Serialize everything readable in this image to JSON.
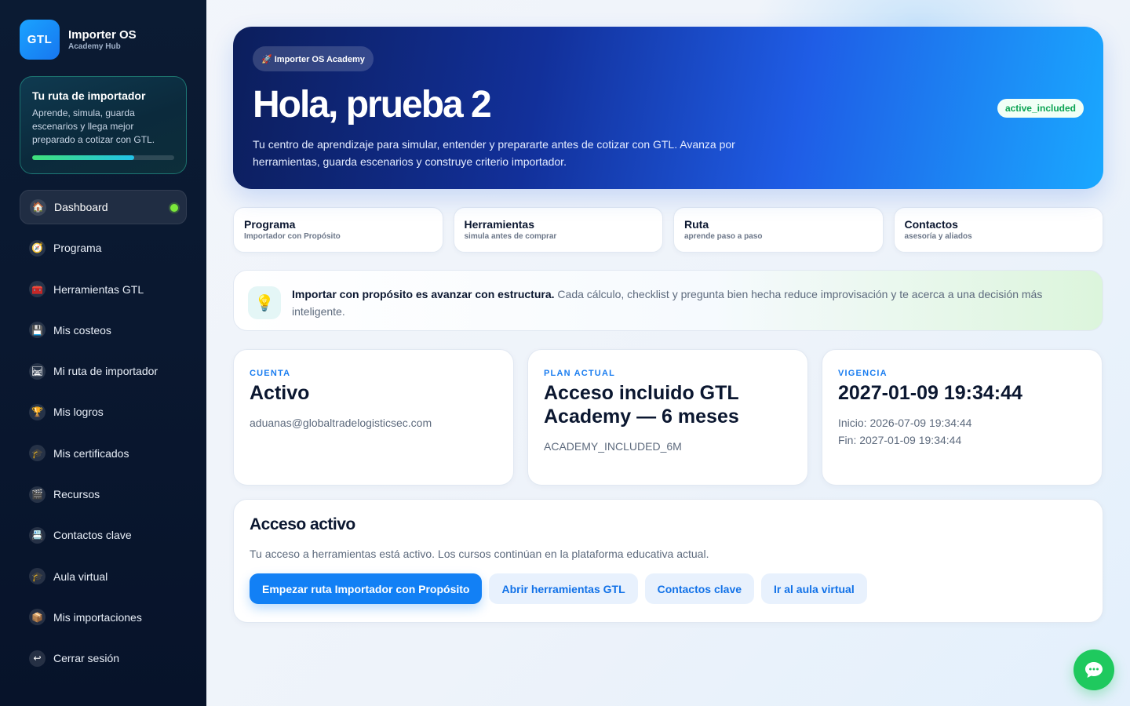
{
  "brand": {
    "logo": "GTL",
    "title": "Importer OS",
    "subtitle": "Academy Hub"
  },
  "route_card": {
    "title": "Tu ruta de importador",
    "text": "Aprende, simula, guarda escenarios y llega mejor preparado a cotizar con GTL.",
    "progress": 0.72
  },
  "nav": [
    {
      "label": "Dashboard",
      "icon": "house-icon",
      "glyph": "🏠",
      "active": true
    },
    {
      "label": "Programa",
      "icon": "compass-icon",
      "glyph": "🧭"
    },
    {
      "label": "Herramientas GTL",
      "icon": "toolbox-icon",
      "glyph": "🧰"
    },
    {
      "label": "Mis costeos",
      "icon": "floppy-disk-icon",
      "glyph": "💾"
    },
    {
      "label": "Mi ruta de importador",
      "icon": "route-icon",
      "glyph": "🛤"
    },
    {
      "label": "Mis logros",
      "icon": "trophy-icon",
      "glyph": "🏆"
    },
    {
      "label": "Mis certificados",
      "icon": "graduation-cap-icon",
      "glyph": "🎓"
    },
    {
      "label": "Recursos",
      "icon": "clapperboard-icon",
      "glyph": "🎬"
    },
    {
      "label": "Contactos clave",
      "icon": "card-index-icon",
      "glyph": "📇"
    },
    {
      "label": "Aula virtual",
      "icon": "graduation-cap-icon",
      "glyph": "🎓"
    },
    {
      "label": "Mis importaciones",
      "icon": "package-icon",
      "glyph": "📦"
    },
    {
      "label": "Cerrar sesión",
      "icon": "logout-arrow-icon",
      "glyph": "↩"
    }
  ],
  "hero": {
    "pill": "🚀 Importer OS Academy",
    "title": "Hola, prueba 2",
    "text": "Tu centro de aprendizaje para simular, entender y prepararte antes de cotizar con GTL. Avanza por herramientas, guarda escenarios y construye criterio importador.",
    "status": "active_included"
  },
  "quick_links": [
    {
      "title": "Programa",
      "sub": "Importador con Propósito"
    },
    {
      "title": "Herramientas",
      "sub": "simula antes de comprar"
    },
    {
      "title": "Ruta",
      "sub": "aprende paso a paso"
    },
    {
      "title": "Contactos",
      "sub": "asesoría y aliados"
    }
  ],
  "tip": {
    "icon": "lightbulb-icon",
    "bold": "Importar con propósito es avanzar con estructura.",
    "text": " Cada cálculo, checklist y pregunta bien hecha reduce improvisación y te acerca a una decisión más inteligente."
  },
  "stats": [
    {
      "kicker": "CUENTA",
      "value": "Activo",
      "lines": [
        "aduanas@globaltradelogisticsec.com"
      ]
    },
    {
      "kicker": "PLAN ACTUAL",
      "value": "Acceso incluido GTL Academy — 6 meses",
      "lines": [
        "ACADEMY_INCLUDED_6M"
      ]
    },
    {
      "kicker": "VIGENCIA",
      "value": "2027-01-09 19:34:44",
      "lines": [
        "Inicio: 2026-07-09 19:34:44",
        "Fin: 2027-01-09 19:34:44"
      ]
    }
  ],
  "access": {
    "title": "Acceso activo",
    "text": "Tu acceso a herramientas está activo. Los cursos continúan en la plataforma educativa actual.",
    "primary": "Empezar ruta Importador con Propósito",
    "secondary": [
      "Abrir herramientas GTL",
      "Contactos clave",
      "Ir al aula virtual"
    ]
  },
  "chat": {
    "icon": "chat-bubble-icon"
  },
  "colors": {
    "accent": "#1280F5",
    "success": "#0AA352",
    "chat": "#1FC95E",
    "sidebar": "#0A1830"
  }
}
